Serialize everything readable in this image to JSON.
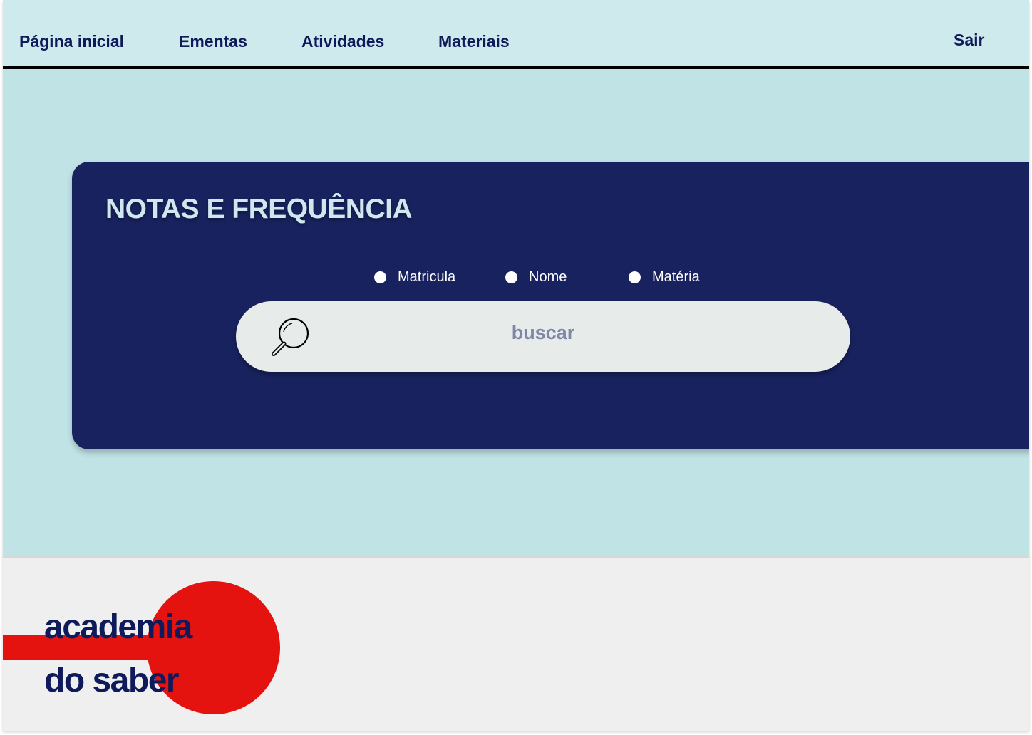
{
  "nav": {
    "home": "Página inicial",
    "ementas": "Ementas",
    "atividades": "Atividades",
    "materiais": "Materiais",
    "logout": "Sair"
  },
  "card": {
    "title": "NOTAS E FREQUÊNCIA",
    "filters": [
      {
        "label": "Matricula"
      },
      {
        "label": "Nome"
      },
      {
        "label": "Matéria"
      }
    ],
    "search": {
      "placeholder": "buscar",
      "icon": "search-icon"
    }
  },
  "footer": {
    "logo_line1": "academia",
    "logo_line2": "do saber"
  },
  "colors": {
    "topbar_bg": "#cfeaed",
    "main_bg": "#c0e3e6",
    "card_bg": "#18225e",
    "nav_text": "#0e1a5a",
    "brand_red": "#e5130f",
    "search_bg": "#e7ecea"
  }
}
